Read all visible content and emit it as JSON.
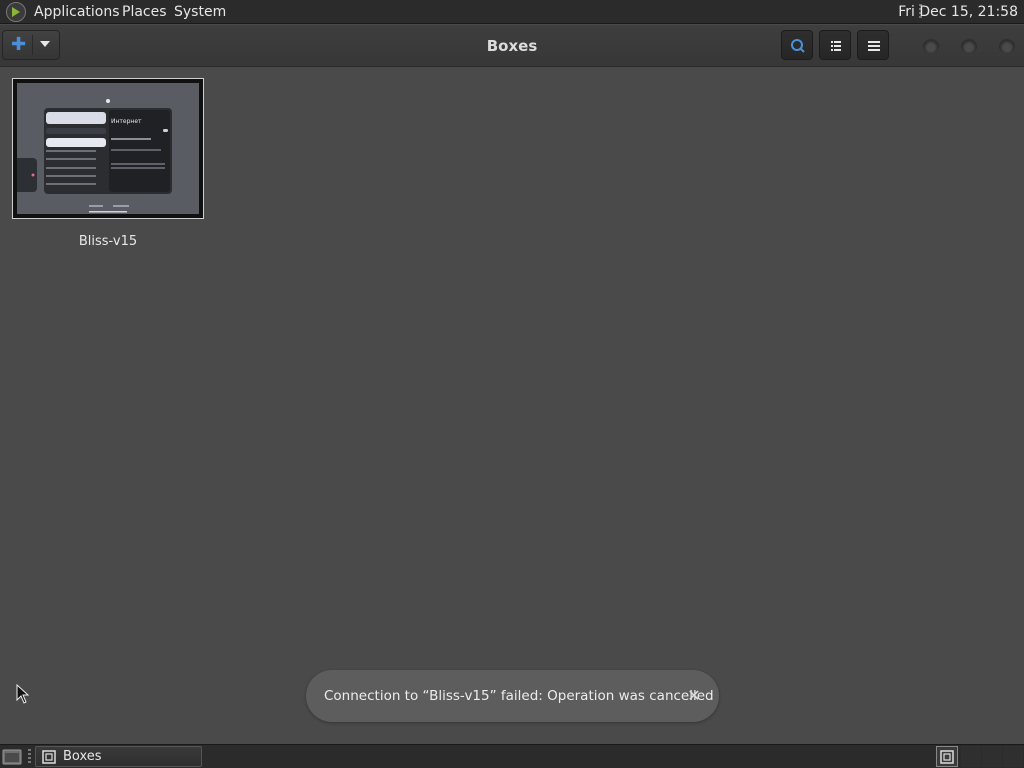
{
  "top_panel": {
    "menus": [
      "Applications",
      "Places",
      "System"
    ],
    "clock": "Fri Dec 15, 21:58"
  },
  "header": {
    "title": "Boxes",
    "new_icon": "plus-icon",
    "search_icon": "search-icon",
    "list_view_icon": "list-view-icon",
    "menu_icon": "hamburger-menu-icon"
  },
  "boxes": [
    {
      "name": "Bliss-v15"
    }
  ],
  "thumbnail_text": {
    "panel_title": "Интернет"
  },
  "notification": {
    "message": "Connection to “Bliss-v15” failed: Operation was cancelled",
    "close_icon": "close-icon"
  },
  "taskbar": {
    "tasks": [
      {
        "label": "Boxes"
      }
    ]
  },
  "colors": {
    "accent": "#4a90d9",
    "background": "#4a4a4a",
    "panel": "#2b2b2b"
  }
}
